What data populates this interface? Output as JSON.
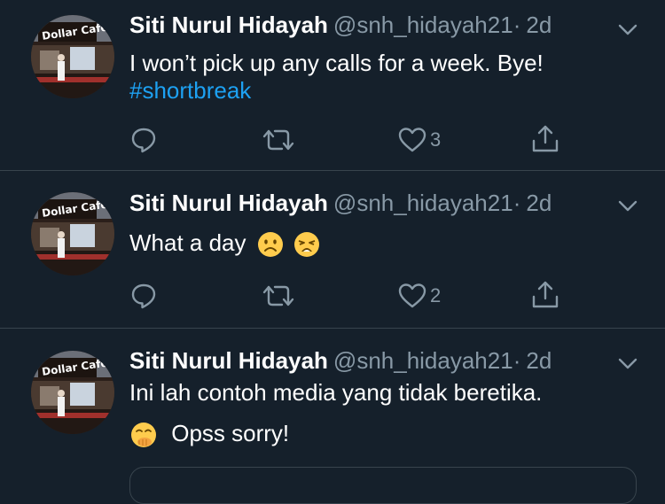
{
  "tweets": [
    {
      "name": "Siti Nurul Hidayah",
      "handle": "@snh_hidayah21",
      "dot": "·",
      "time": "2d",
      "line1": "I won’t pick up any calls for a week. Bye!",
      "hashtag": "#shortbreak",
      "likes": "3"
    },
    {
      "name": "Siti Nurul Hidayah",
      "handle": "@snh_hidayah21",
      "dot": "·",
      "time": "2d",
      "line1": "What a day",
      "emojis": [
        "frowning-face",
        "weary-face"
      ],
      "likes": "2"
    },
    {
      "name": "Siti Nurul Hidayah",
      "handle": "@snh_hidayah21",
      "dot": "·",
      "time": "2d",
      "line1": "Ini lah contoh media yang tidak beretika.",
      "line2": "Opss sorry!",
      "emojis": [
        "hand-over-mouth-face"
      ]
    }
  ],
  "colors": {
    "background": "#15202b",
    "text": "#ffffff",
    "muted": "#8899a6",
    "link": "#1da1f2",
    "divider": "#38444d"
  }
}
